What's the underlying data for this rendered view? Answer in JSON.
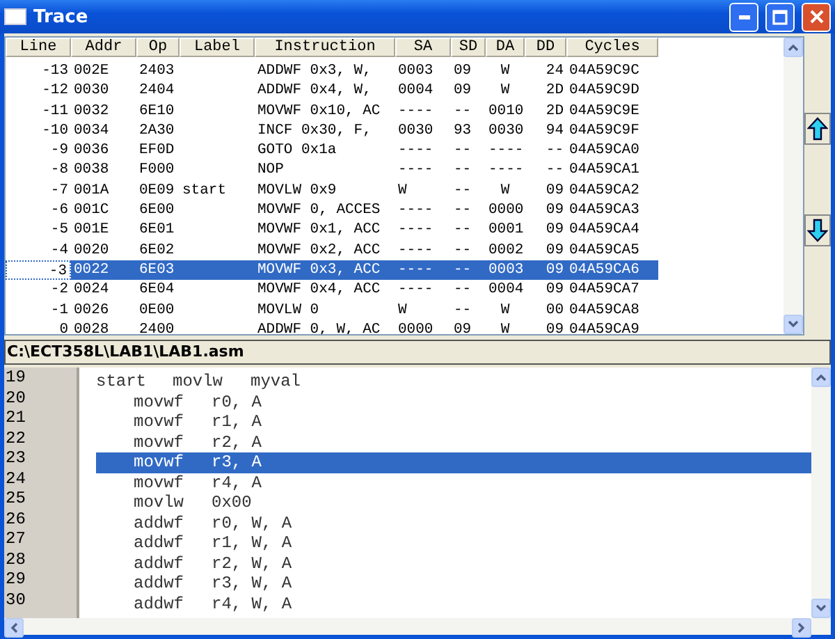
{
  "window": {
    "title": "Trace"
  },
  "trace": {
    "columns": [
      "Line",
      "Addr",
      "Op",
      "Label",
      "Instruction",
      "SA",
      "SD",
      "DA",
      "DD",
      "Cycles"
    ],
    "rows": [
      {
        "line": "-13",
        "addr": "002E",
        "op": "2403",
        "instruction": "ADDWF 0x3, W,",
        "sa": "0003",
        "sd": "09",
        "da": "W",
        "dd": "24",
        "cycles": "04A59C9C",
        "selected": false
      },
      {
        "line": "-12",
        "addr": "0030",
        "op": "2404",
        "instruction": "ADDWF 0x4, W,",
        "sa": "0004",
        "sd": "09",
        "da": "W",
        "dd": "2D",
        "cycles": "04A59C9D",
        "selected": false
      },
      {
        "line": "-11",
        "addr": "0032",
        "op": "6E10",
        "instruction": "MOVWF 0x10, AC",
        "sa": "----",
        "sd": "--",
        "da": "0010",
        "dd": "2D",
        "cycles": "04A59C9E",
        "selected": false
      },
      {
        "line": "-10",
        "addr": "0034",
        "op": "2A30",
        "instruction": "INCF 0x30, F,",
        "sa": "0030",
        "sd": "93",
        "da": "0030",
        "dd": "94",
        "cycles": "04A59C9F",
        "selected": false
      },
      {
        "line": "-9",
        "addr": "0036",
        "op": "EF0D",
        "instruction": "GOTO 0x1a",
        "sa": "----",
        "sd": "--",
        "da": "----",
        "dd": "--",
        "cycles": "04A59CA0",
        "selected": false
      },
      {
        "line": "-8",
        "addr": "0038",
        "op": "F000",
        "instruction": "NOP",
        "sa": "----",
        "sd": "--",
        "da": "----",
        "dd": "--",
        "cycles": "04A59CA1",
        "selected": false
      },
      {
        "line": "-7",
        "addr": "001A",
        "op": "0E09",
        "label": "start",
        "instruction": "MOVLW 0x9",
        "sa": "W",
        "sd": "--",
        "da": "W",
        "dd": "09",
        "cycles": "04A59CA2",
        "selected": false
      },
      {
        "line": "-6",
        "addr": "001C",
        "op": "6E00",
        "instruction": "MOVWF 0, ACCES",
        "sa": "----",
        "sd": "--",
        "da": "0000",
        "dd": "09",
        "cycles": "04A59CA3",
        "selected": false
      },
      {
        "line": "-5",
        "addr": "001E",
        "op": "6E01",
        "instruction": "MOVWF 0x1, ACC",
        "sa": "----",
        "sd": "--",
        "da": "0001",
        "dd": "09",
        "cycles": "04A59CA4",
        "selected": false
      },
      {
        "line": "-4",
        "addr": "0020",
        "op": "6E02",
        "instruction": "MOVWF 0x2, ACC",
        "sa": "----",
        "sd": "--",
        "da": "0002",
        "dd": "09",
        "cycles": "04A59CA5",
        "selected": false
      },
      {
        "line": "-3",
        "addr": "0022",
        "op": "6E03",
        "instruction": "MOVWF 0x3, ACC",
        "sa": "----",
        "sd": "--",
        "da": "0003",
        "dd": "09",
        "cycles": "04A59CA6",
        "selected": true
      },
      {
        "line": "-2",
        "addr": "0024",
        "op": "6E04",
        "instruction": "MOVWF 0x4, ACC",
        "sa": "----",
        "sd": "--",
        "da": "0004",
        "dd": "09",
        "cycles": "04A59CA7",
        "selected": false
      },
      {
        "line": "-1",
        "addr": "0026",
        "op": "0E00",
        "instruction": "MOVLW 0",
        "sa": "W",
        "sd": "--",
        "da": "W",
        "dd": "00",
        "cycles": "04A59CA8",
        "selected": false
      },
      {
        "line": "0",
        "addr": "0028",
        "op": "2400",
        "instruction": "ADDWF 0, W, AC",
        "sa": "0000",
        "sd": "09",
        "da": "W",
        "dd": "09",
        "cycles": "04A59CA9",
        "selected": false
      }
    ]
  },
  "file_path": "C:\\ECT358L\\LAB1\\LAB1.asm",
  "source": {
    "lines": [
      {
        "number": "19",
        "label": "start",
        "mnemonic": "movlw",
        "operands": "myval",
        "selected": false
      },
      {
        "number": "20",
        "mnemonic": "movwf",
        "operands": "r0, A",
        "selected": false
      },
      {
        "number": "21",
        "mnemonic": "movwf",
        "operands": "r1, A",
        "selected": false
      },
      {
        "number": "22",
        "mnemonic": "movwf",
        "operands": "r2, A",
        "selected": false
      },
      {
        "number": "23",
        "mnemonic": "movwf",
        "operands": "r3, A",
        "selected": true
      },
      {
        "number": "24",
        "mnemonic": "movwf",
        "operands": "r4, A",
        "selected": false
      },
      {
        "number": "25",
        "mnemonic": "movlw",
        "operands": "0x00",
        "selected": false
      },
      {
        "number": "26",
        "mnemonic": "addwf",
        "operands": "r0, W, A",
        "selected": false
      },
      {
        "number": "27",
        "mnemonic": "addwf",
        "operands": "r1, W, A",
        "selected": false
      },
      {
        "number": "28",
        "mnemonic": "addwf",
        "operands": "r2, W, A",
        "selected": false
      },
      {
        "number": "29",
        "mnemonic": "addwf",
        "operands": "r3, W, A",
        "selected": false
      },
      {
        "number": "30",
        "mnemonic": "addwf",
        "operands": "r4, W, A",
        "selected": false
      }
    ]
  }
}
